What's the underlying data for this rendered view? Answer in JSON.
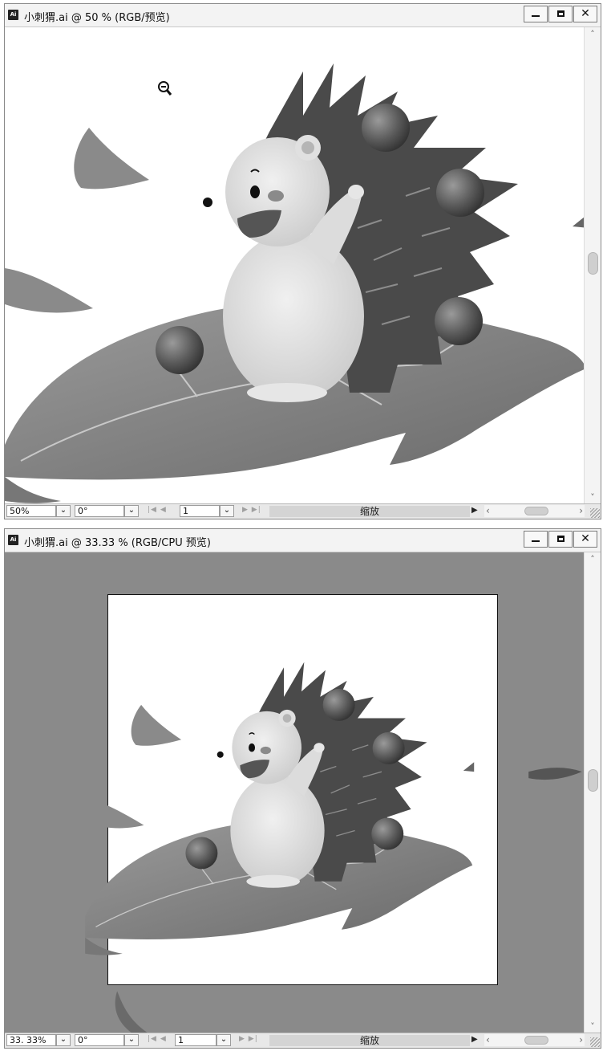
{
  "windows": [
    {
      "title": "小刺猬.ai @ 50 % (RGB/预览)",
      "status": {
        "zoom_value": "50%",
        "rotation_value": "0°",
        "artboard_value": "1",
        "mode_label": "缩放"
      }
    },
    {
      "title": "小刺猬.ai @ 33.33 % (RGB/CPU 预览)",
      "status": {
        "zoom_value": "33. 33%",
        "rotation_value": "0°",
        "artboard_value": "1",
        "mode_label": "缩放"
      }
    }
  ],
  "icons": {
    "app": "ai-document-icon",
    "cursor": "zoom-out-cursor-icon"
  },
  "colors": {
    "canvas_gray": "#8a8a8a",
    "title_bg": "#f3f3f3",
    "status_bg": "#e8e8e8"
  }
}
